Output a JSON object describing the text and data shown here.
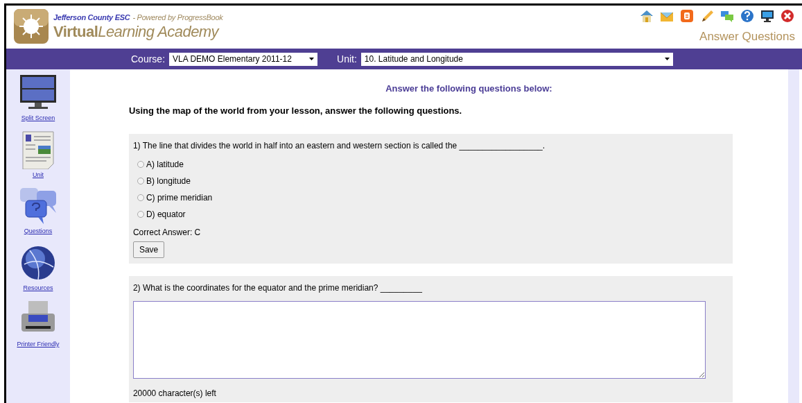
{
  "header": {
    "org": "Jefferson County ESC",
    "powered": "- Powered by ProgressBook",
    "brand_bold": "Virtual",
    "brand_rest": "Learning Academy",
    "page_title": "Answer Questions"
  },
  "toolbar": [
    {
      "kind": "home"
    },
    {
      "kind": "mail"
    },
    {
      "kind": "blog"
    },
    {
      "kind": "pencil"
    },
    {
      "kind": "chat"
    },
    {
      "kind": "help"
    },
    {
      "kind": "monitor"
    },
    {
      "kind": "close"
    }
  ],
  "course_bar": {
    "course_label": "Course:",
    "course_value": "VLA DEMO Elementary 2011-12",
    "unit_label": "Unit:",
    "unit_value": "10. Latitude and Longitude"
  },
  "sidebar": {
    "items": [
      {
        "kind": "split",
        "label": "Split Screen"
      },
      {
        "kind": "unit",
        "label": "Unit"
      },
      {
        "kind": "questions",
        "label": "Questions"
      },
      {
        "kind": "resources",
        "label": "Resources"
      },
      {
        "kind": "printer",
        "label": "Printer Friendly"
      }
    ]
  },
  "heading": "Answer the following questions below:",
  "instructions": "Using the map of the world from your lesson, answer the following questions.",
  "questions": [
    {
      "kind": "choice",
      "prompt": "1) The line that divides the world in half into an eastern and western section is called the __________________.",
      "options": [
        {
          "label": "A) latitude",
          "selected": false
        },
        {
          "label": "B) longitude",
          "selected": false
        },
        {
          "label": "C) prime meridian",
          "selected": false
        },
        {
          "label": "D) equator",
          "selected": false
        }
      ],
      "answer": "Correct Answer: C",
      "button": "Save"
    },
    {
      "kind": "text",
      "prompt": "2) What is the coordinates for the equator and the prime meridian? _________",
      "counter": "20000 character(s) left"
    }
  ]
}
